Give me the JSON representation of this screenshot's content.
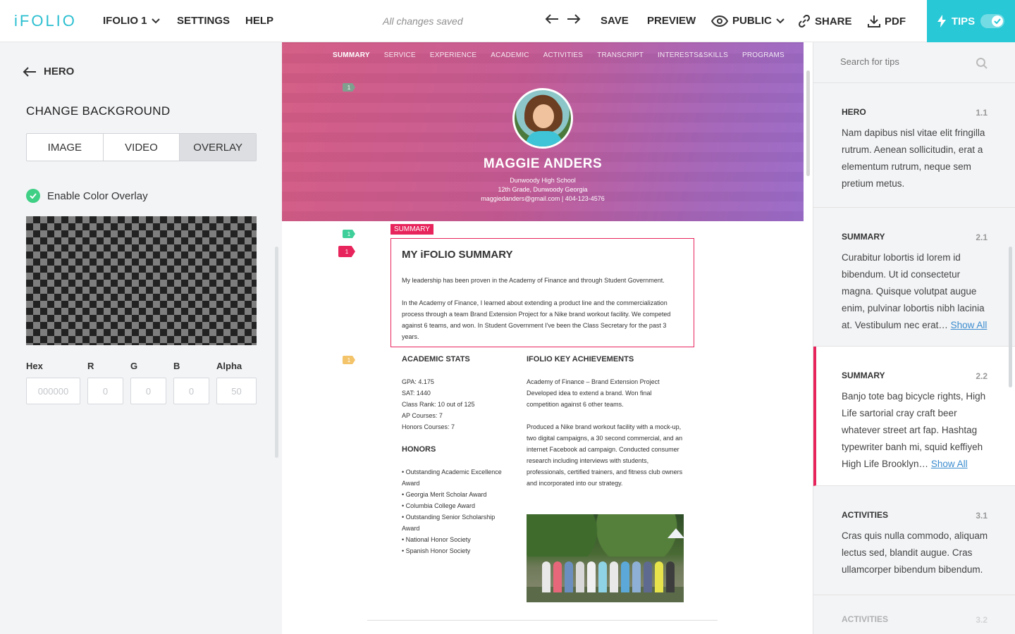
{
  "topbar": {
    "logo": "iFOLIO",
    "folio_menu": "iFOLIO 1",
    "settings": "SETTINGS",
    "help": "HELP",
    "status": "All changes saved",
    "save": "SAVE",
    "preview": "PREVIEW",
    "visibility": "PUBLIC",
    "share": "SHARE",
    "pdf": "PDF",
    "tips": "TIPS",
    "tips_enabled": true
  },
  "left_panel": {
    "back_label": "HERO",
    "title": "CHANGE BACKGROUND",
    "segments": [
      "IMAGE",
      "VIDEO",
      "OVERLAY"
    ],
    "active_segment": "OVERLAY",
    "overlay_label": "Enable Color Overlay",
    "overlay_enabled": true,
    "fields": {
      "hex": {
        "label": "Hex",
        "placeholder": "000000"
      },
      "r": {
        "label": "R",
        "placeholder": "0"
      },
      "g": {
        "label": "G",
        "placeholder": "0"
      },
      "b": {
        "label": "B",
        "placeholder": "0"
      },
      "alpha": {
        "label": "Alpha",
        "placeholder": "50"
      }
    }
  },
  "hero": {
    "nav": [
      "SUMMARY",
      "SERVICE",
      "EXPERIENCE",
      "ACADEMIC",
      "ACTIVITIES",
      "TRANSCRIPT",
      "INTERESTS&SKILLS",
      "PROGRAMS"
    ],
    "name": "MAGGIE ANDERS",
    "school": "Dunwoody High School",
    "grade": "12th Grade, Dunwoody Georgia",
    "contact": "maggiedanders@gmail.com   |   404-123-4576"
  },
  "pins": {
    "hero": "1",
    "summary_green": "1",
    "summary_red": "1",
    "stats": "1"
  },
  "summary": {
    "tag": "SUMMARY",
    "title": "MY iFOLIO SUMMARY",
    "p1": "My leadership has been proven in the Academy of Finance and through Student Government.",
    "p2": "In the Academy of Finance, I learned about extending a product line and the commercialization process through a team Brand Extension Project for a Nike brand workout facility. We competed against 6 teams, and won. In Student Government I've been the Class Secretary for the past 3 years."
  },
  "academic": {
    "stats_title": "ACADEMIC STATS",
    "stats": [
      "GPA: 4.175",
      "SAT: 1440",
      "Class Rank: 10 out of 125",
      "AP Courses: 7",
      "Honors Courses: 7"
    ],
    "honors_title": "HONORS",
    "honors": [
      "• Outstanding Academic Excellence Award",
      "• Georgia Merit Scholar Award",
      "• Columbia College Award",
      "• Outstanding Senior Scholarship Award",
      "• National Honor Society",
      "• Spanish Honor Society"
    ],
    "ach_title": "IFOLIO KEY ACHIEVEMENTS",
    "ach1": "Academy of Finance – Brand Extension Project Developed idea to extend a brand.  Won final competition against 6 other teams.",
    "ach2": "Produced a Nike brand workout facility with a mock-up, two digital campaigns, a 30 second commercial, and an internet Facebook ad campaign. Conducted consumer research including interviews with students, professionals, certified trainers, and fitness club owners and incorporated into our strategy."
  },
  "tips_panel": {
    "search_placeholder": "Search for tips",
    "show_all": "Show All",
    "items": [
      {
        "title": "HERO",
        "num": "1.1",
        "text": "Nam dapibus nisl vitae elit fringilla rutrum. Aenean sollicitudin, erat a elementum rutrum, neque sem pretium metus."
      },
      {
        "title": "SUMMARY",
        "num": "2.1",
        "text": "Curabitur lobortis id lorem id bibendum. Ut id consectetur magna. Quisque volutpat augue enim, pulvinar lobortis nibh lacinia at. Vestibulum nec erat…"
      },
      {
        "title": "SUMMARY",
        "num": "2.2",
        "text": "Banjo tote bag bicycle rights, High Life sartorial cray craft beer whatever street art fap. Hashtag typewriter banh mi, squid keffiyeh High Life Brooklyn…"
      },
      {
        "title": "ACTIVITIES",
        "num": "3.1",
        "text": "Cras quis nulla commodo, aliquam lectus sed, blandit augue. Cras ullamcorper bibendum bibendum."
      },
      {
        "title": "ACTIVITIES",
        "num": "3.2",
        "text": ""
      }
    ]
  }
}
